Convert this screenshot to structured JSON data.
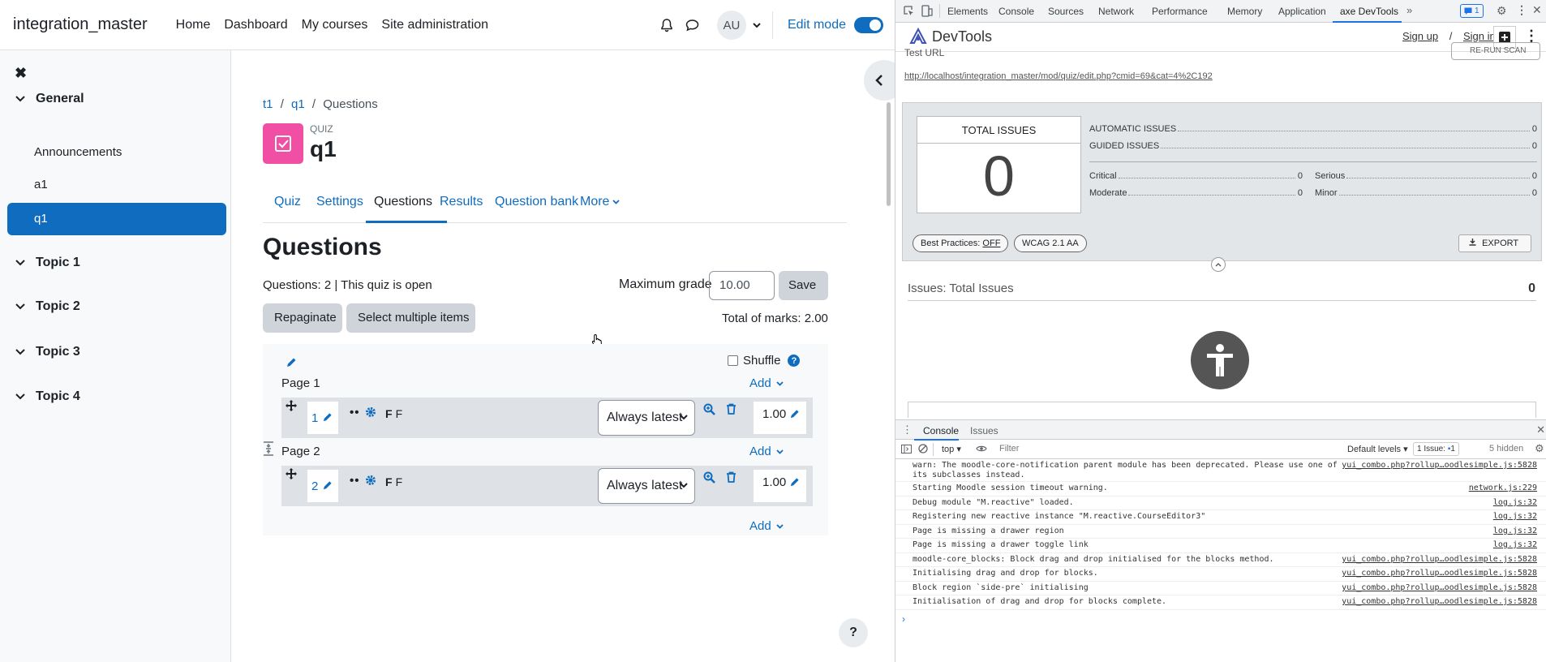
{
  "navbar": {
    "brand": "integration_master",
    "links": [
      "Home",
      "Dashboard",
      "My courses",
      "Site administration"
    ],
    "avatar_initials": "AU",
    "edit_mode_label": "Edit mode"
  },
  "drawer": {
    "sections": [
      {
        "title": "General",
        "items": [
          "Announcements",
          "a1",
          "q1"
        ]
      },
      {
        "title": "Topic 1"
      },
      {
        "title": "Topic 2"
      },
      {
        "title": "Topic 3"
      },
      {
        "title": "Topic 4"
      }
    ],
    "active_item": "q1"
  },
  "breadcrumb": {
    "items": [
      "t1",
      "q1"
    ],
    "current": "Questions",
    "sep": "/"
  },
  "quiz": {
    "type_label": "QUIZ",
    "name": "q1"
  },
  "tabs": [
    "Quiz",
    "Settings",
    "Questions",
    "Results",
    "Question bank",
    "More"
  ],
  "questions_page": {
    "heading": "Questions",
    "info": "Questions: 2 | This quiz is open",
    "max_grade_label": "Maximum grade",
    "max_grade_value": "10.00",
    "save_label": "Save",
    "repaginate_label": "Repaginate",
    "select_multiple_label": "Select multiple items",
    "total_marks": "Total of marks: 2.00",
    "shuffle_label": "Shuffle",
    "add_label": "Add",
    "pages": [
      {
        "label": "Page 1",
        "question": {
          "num": "1",
          "name_a": "F",
          "name_b": "F",
          "version": "Always latest",
          "mark": "1.00"
        }
      },
      {
        "label": "Page 2",
        "question": {
          "num": "2",
          "name_a": "F",
          "name_b": "F",
          "version": "Always latest",
          "mark": "1.00"
        }
      }
    ]
  },
  "devtools": {
    "tabs": [
      "Elements",
      "Console",
      "Sources",
      "Network",
      "Performance",
      "Memory",
      "Application",
      "axe DevTools"
    ],
    "issue_count_badge": "1",
    "axe": {
      "title": "DevTools",
      "sign_up": "Sign up",
      "sign_in": "Sign in",
      "test_url_label": "Test URL",
      "rerun_label": "RE-RUN SCAN",
      "test_url": "http://localhost/integration_master/mod/quiz/edit.php?cmid=69&cat=4%2C192",
      "total_issues_label": "TOTAL ISSUES",
      "total_issues": "0",
      "automatic_label": "AUTOMATIC ISSUES",
      "automatic": "0",
      "guided_label": "GUIDED ISSUES",
      "guided": "0",
      "critical_label": "Critical",
      "critical": "0",
      "serious_label": "Serious",
      "serious": "0",
      "moderate_label": "Moderate",
      "moderate": "0",
      "minor_label": "Minor",
      "minor": "0",
      "best_practices_label": "Best Practices:",
      "best_practices_value": "OFF",
      "wcag_label": "WCAG 2.1 AA",
      "export_label": "EXPORT",
      "issues_title": "Issues: Total Issues",
      "issues_count": "0"
    },
    "console": {
      "tabs": [
        "Console",
        "Issues"
      ],
      "context": "top",
      "filter_placeholder": "Filter",
      "levels": "Default levels",
      "issue_badge_text": "1 Issue:",
      "issue_badge_count": "1",
      "hidden": "5 hidden",
      "logs": [
        {
          "msg": "warn: The moodle-core-notification parent module has been deprecated. Please use one of its subclasses instead.",
          "src": "yui_combo.php?rollup…oodlesimple.js:5828"
        },
        {
          "msg": "Starting Moodle session timeout warning.",
          "src": "network.js:229"
        },
        {
          "msg": "Debug module \"M.reactive\" loaded.",
          "src": "log.js:32"
        },
        {
          "msg": "Registering new reactive instance \"M.reactive.CourseEditor3\"",
          "src": "log.js:32"
        },
        {
          "msg": "Page is missing a drawer region",
          "src": "log.js:32"
        },
        {
          "msg": "Page is missing a drawer toggle link",
          "src": "log.js:32"
        },
        {
          "msg": "moodle-core_blocks: Block drag and drop initialised for the blocks method.",
          "src": "yui_combo.php?rollup…oodlesimple.js:5828"
        },
        {
          "msg": "Initialising drag and drop for blocks.",
          "src": "yui_combo.php?rollup…oodlesimple.js:5828"
        },
        {
          "msg": "Block region `side-pre` initialising",
          "src": "yui_combo.php?rollup…oodlesimple.js:5828"
        },
        {
          "msg": "Initialisation of drag and drop for blocks complete.",
          "src": "yui_combo.php?rollup…oodlesimple.js:5828"
        }
      ]
    }
  }
}
